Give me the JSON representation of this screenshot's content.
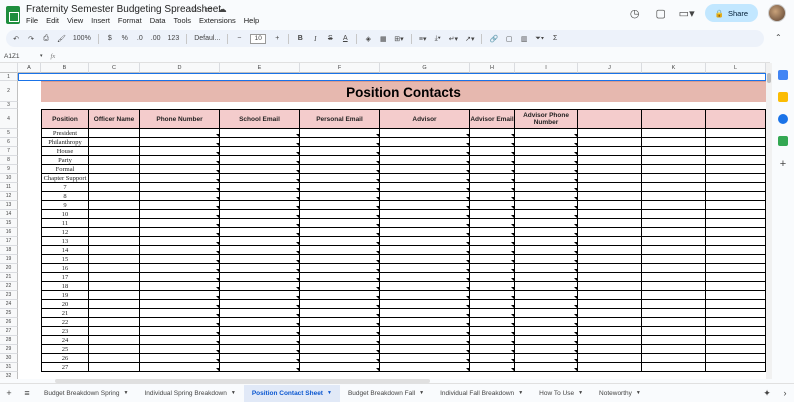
{
  "title": {
    "doc_name": "Fraternity Semester Budgeting Spreadsheet.",
    "menus": [
      "File",
      "Edit",
      "View",
      "Insert",
      "Format",
      "Data",
      "Tools",
      "Extensions",
      "Help"
    ],
    "share_label": "Share"
  },
  "toolbar": {
    "zoom": "100%",
    "currency": "$",
    "percent": "%",
    "decrease_decimal": ".0",
    "increase_decimal": ".00",
    "number_format": "123",
    "font": "Defaul...",
    "font_size": "10",
    "bold": "B",
    "italic": "I",
    "strike": "S",
    "text_color": "A",
    "functions": "Σ"
  },
  "formula_bar": {
    "name_box": "A1Z1",
    "fx": "fx",
    "value": ""
  },
  "columns": [
    "A",
    "B",
    "C",
    "D",
    "E",
    "F",
    "G",
    "H",
    "I",
    "J",
    "K",
    "L"
  ],
  "sheet": {
    "banner": "Position Contacts",
    "headers": [
      "Position",
      "Officer Name",
      "Phone Number",
      "School Email",
      "Personal Email",
      "Advisor",
      "Advisor Email",
      "Advisor Phone Number",
      "",
      "",
      ""
    ],
    "positions": [
      "President",
      "Philanthropy",
      "House",
      "Party",
      "Formal",
      "Chapter Support",
      "7",
      "8",
      "9",
      "10",
      "11",
      "12",
      "13",
      "14",
      "15",
      "16",
      "17",
      "18",
      "19",
      "20",
      "21",
      "22",
      "23",
      "24",
      "25",
      "26",
      "27"
    ],
    "row_numbers": [
      "1",
      "2",
      "3",
      "4",
      "5",
      "6",
      "7",
      "8",
      "9",
      "10",
      "11",
      "12",
      "13",
      "14",
      "15",
      "16",
      "17",
      "18",
      "19",
      "20",
      "21",
      "22",
      "23",
      "24",
      "25",
      "26",
      "27",
      "28",
      "29",
      "30",
      "31",
      "32"
    ]
  },
  "tabs": [
    {
      "label": "Budget Breakdown Spring",
      "active": false
    },
    {
      "label": "Individual Spring Breakdown",
      "active": false
    },
    {
      "label": "Position Contact Sheet",
      "active": true
    },
    {
      "label": "Budget Breakdown Fall",
      "active": false
    },
    {
      "label": "Individual Fall Breakdown",
      "active": false
    },
    {
      "label": "How To Use",
      "active": false
    },
    {
      "label": "Noteworthy",
      "active": false
    }
  ],
  "colors": {
    "banner": "#e6b8af",
    "header": "#f4cccc",
    "active_tab": "#0b57d0",
    "share": "#c2e7ff"
  }
}
